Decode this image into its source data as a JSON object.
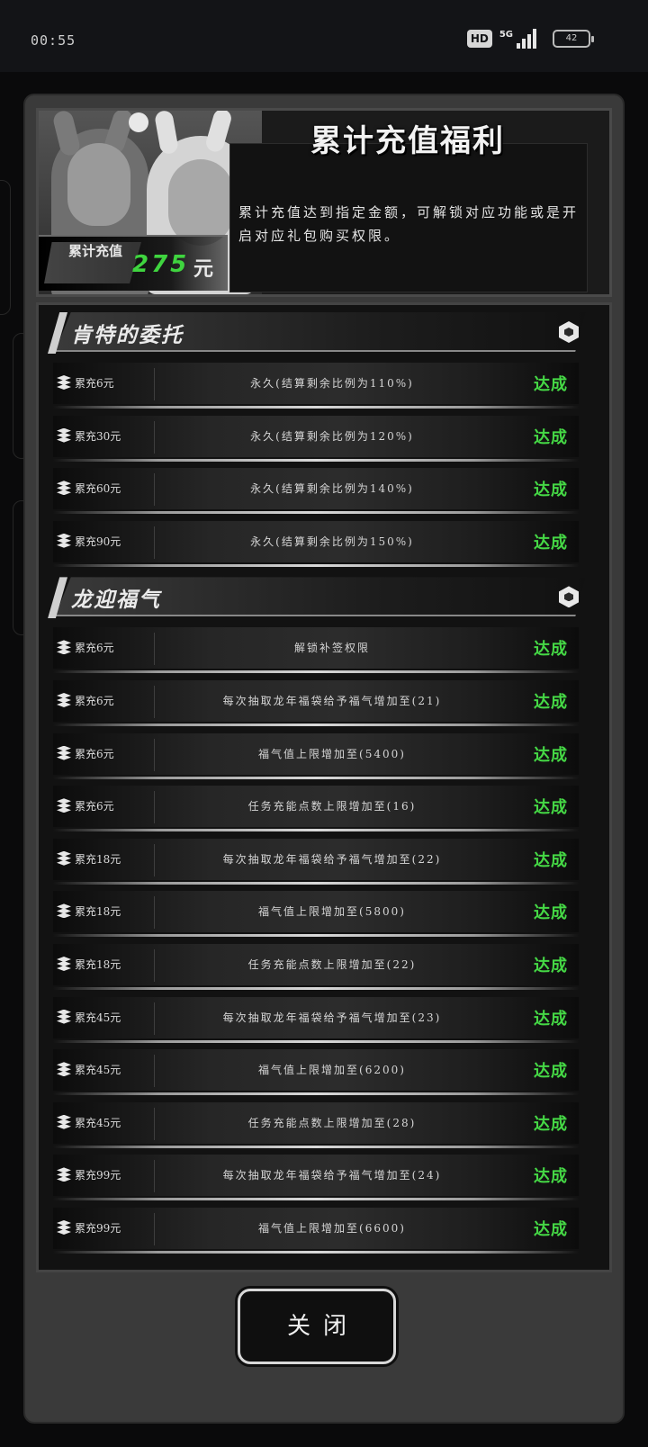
{
  "status_bar": {
    "time": "00:55",
    "hd_badge": "HD",
    "network": "5G",
    "battery": "42"
  },
  "header": {
    "title": "累计充值福利",
    "description": "累计充值达到指定金额，可解锁对应功能或是开启对应礼包购买权限。",
    "amount_label": "累计充值",
    "amount_value": "275",
    "amount_unit": "元"
  },
  "sections": [
    {
      "title": "肯特的委托",
      "rows": [
        {
          "need": "累充6元",
          "desc": "永久(结算剩余比例为110%)",
          "status": "达成"
        },
        {
          "need": "累充30元",
          "desc": "永久(结算剩余比例为120%)",
          "status": "达成"
        },
        {
          "need": "累充60元",
          "desc": "永久(结算剩余比例为140%)",
          "status": "达成"
        },
        {
          "need": "累充90元",
          "desc": "永久(结算剩余比例为150%)",
          "status": "达成"
        }
      ]
    },
    {
      "title": "龙迎福气",
      "rows": [
        {
          "need": "累充6元",
          "desc": "解锁补签权限",
          "status": "达成"
        },
        {
          "need": "累充6元",
          "desc": "每次抽取龙年福袋给予福气增加至(21)",
          "status": "达成"
        },
        {
          "need": "累充6元",
          "desc": "福气值上限增加至(5400)",
          "status": "达成"
        },
        {
          "need": "累充6元",
          "desc": "任务充能点数上限增加至(16)",
          "status": "达成"
        },
        {
          "need": "累充18元",
          "desc": "每次抽取龙年福袋给予福气增加至(22)",
          "status": "达成"
        },
        {
          "need": "累充18元",
          "desc": "福气值上限增加至(5800)",
          "status": "达成"
        },
        {
          "need": "累充18元",
          "desc": "任务充能点数上限增加至(22)",
          "status": "达成"
        },
        {
          "need": "累充45元",
          "desc": "每次抽取龙年福袋给予福气增加至(23)",
          "status": "达成"
        },
        {
          "need": "累充45元",
          "desc": "福气值上限增加至(6200)",
          "status": "达成"
        },
        {
          "need": "累充45元",
          "desc": "任务充能点数上限增加至(28)",
          "status": "达成"
        },
        {
          "need": "累充99元",
          "desc": "每次抽取龙年福袋给予福气增加至(24)",
          "status": "达成"
        },
        {
          "need": "累充99元",
          "desc": "福气值上限增加至(6600)",
          "status": "达成"
        }
      ]
    }
  ],
  "close_button": "关闭",
  "colors": {
    "achieved": "#45d845",
    "amount": "#3fd43f"
  }
}
